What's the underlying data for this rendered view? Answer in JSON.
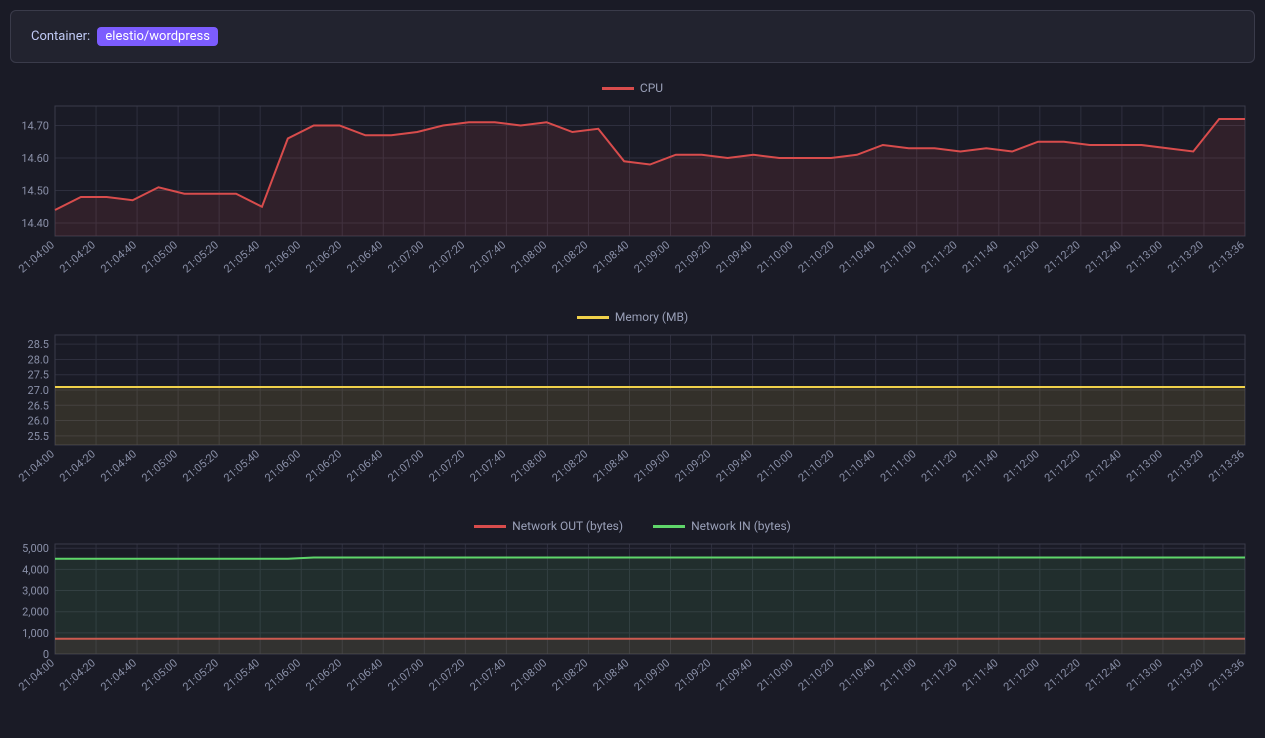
{
  "header": {
    "label": "Container:",
    "badge": "elestio/wordpress"
  },
  "colors": {
    "cpu": "#d84c4c",
    "cpu_fill": "rgba(216,76,76,0.12)",
    "memory": "#f0d14a",
    "memory_fill": "rgba(240,209,74,0.12)",
    "net_out": "#d84c4c",
    "net_out_fill": "rgba(216,76,76,0.10)",
    "net_in": "#5fd66a",
    "net_in_fill": "rgba(95,214,106,0.10)"
  },
  "x_categories": [
    "21:04:00",
    "21:04:20",
    "21:04:40",
    "21:05:00",
    "21:05:20",
    "21:05:40",
    "21:06:00",
    "21:06:20",
    "21:06:40",
    "21:07:00",
    "21:07:20",
    "21:07:40",
    "21:08:00",
    "21:08:20",
    "21:08:40",
    "21:09:00",
    "21:09:20",
    "21:09:40",
    "21:10:00",
    "21:10:20",
    "21:10:40",
    "21:11:00",
    "21:11:20",
    "21:11:40",
    "21:12:00",
    "21:12:20",
    "21:12:40",
    "21:13:00",
    "21:13:20",
    "21:13:36"
  ],
  "chart_data": [
    {
      "id": "cpu",
      "type": "line",
      "title": "CPU",
      "series": [
        {
          "name": "CPU",
          "color_key": "cpu",
          "fill_key": "cpu_fill",
          "values": [
            14.44,
            14.48,
            14.48,
            14.47,
            14.51,
            14.49,
            14.49,
            14.49,
            14.45,
            14.66,
            14.7,
            14.7,
            14.67,
            14.67,
            14.68,
            14.7,
            14.71,
            14.71,
            14.7,
            14.71,
            14.68,
            14.69,
            14.59,
            14.58,
            14.61,
            14.61,
            14.6,
            14.61,
            14.6,
            14.6,
            14.6,
            14.61,
            14.64,
            14.63,
            14.63,
            14.62,
            14.63,
            14.62,
            14.65,
            14.65,
            14.64,
            14.64,
            14.64,
            14.63,
            14.62,
            14.72,
            14.72
          ]
        }
      ],
      "y_ticks": [
        14.4,
        14.5,
        14.6,
        14.7
      ],
      "y_range": [
        14.36,
        14.76
      ],
      "height": 130
    },
    {
      "id": "memory",
      "type": "line",
      "title": "Memory (MB)",
      "series": [
        {
          "name": "Memory (MB)",
          "color_key": "memory",
          "fill_key": "memory_fill",
          "values": [
            27.1,
            27.1,
            27.1,
            27.1,
            27.1,
            27.1,
            27.1,
            27.1,
            27.1,
            27.1,
            27.1,
            27.1,
            27.1,
            27.1,
            27.1,
            27.1,
            27.1,
            27.1,
            27.1,
            27.1,
            27.1,
            27.1,
            27.1,
            27.1,
            27.1,
            27.1,
            27.1,
            27.1,
            27.1,
            27.1,
            27.1,
            27.1,
            27.1,
            27.1,
            27.1,
            27.1,
            27.1,
            27.1,
            27.1,
            27.1,
            27.1,
            27.1,
            27.1,
            27.1,
            27.1,
            27.1,
            27.1
          ]
        }
      ],
      "y_ticks": [
        25.5,
        26.0,
        26.5,
        27.0,
        27.5,
        28.0,
        28.5
      ],
      "y_range": [
        25.2,
        28.8
      ],
      "height": 110
    },
    {
      "id": "network",
      "type": "line",
      "title_series": [
        "Network OUT (bytes)",
        "Network IN (bytes)"
      ],
      "series": [
        {
          "name": "Network OUT (bytes)",
          "color_key": "net_out",
          "fill_key": "net_out_fill",
          "values": [
            720,
            720,
            720,
            720,
            720,
            720,
            720,
            720,
            720,
            720,
            720,
            720,
            720,
            720,
            720,
            720,
            720,
            720,
            720,
            720,
            720,
            720,
            720,
            720,
            720,
            720,
            720,
            720,
            720,
            720,
            720,
            720,
            720,
            720,
            720,
            720,
            720,
            720,
            720,
            720,
            720,
            720,
            720,
            720,
            720,
            720,
            720
          ]
        },
        {
          "name": "Network IN (bytes)",
          "color_key": "net_in",
          "fill_key": "net_in_fill",
          "values": [
            4500,
            4500,
            4500,
            4500,
            4500,
            4500,
            4500,
            4500,
            4500,
            4500,
            4560,
            4560,
            4560,
            4560,
            4560,
            4560,
            4560,
            4560,
            4560,
            4560,
            4560,
            4560,
            4560,
            4560,
            4560,
            4560,
            4560,
            4560,
            4560,
            4560,
            4560,
            4560,
            4560,
            4560,
            4560,
            4560,
            4560,
            4560,
            4560,
            4560,
            4560,
            4560,
            4560,
            4560,
            4560,
            4560,
            4560
          ]
        }
      ],
      "y_ticks": [
        0,
        1000,
        2000,
        3000,
        4000,
        5000
      ],
      "y_range": [
        0,
        5200
      ],
      "height": 110
    }
  ]
}
